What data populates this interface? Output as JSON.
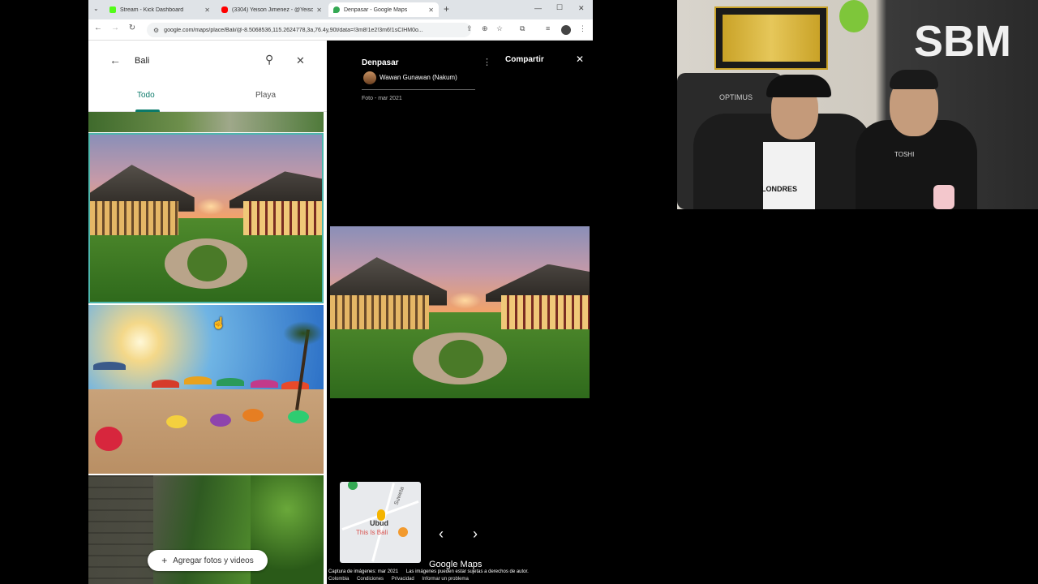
{
  "browser": {
    "tabs": [
      {
        "title": "Stream - Kick Dashboard",
        "favicon_color": "#53fc18"
      },
      {
        "title": "(3304) Yeison Jimenez - @Yeiso",
        "favicon_color": "#ff0000"
      },
      {
        "title": "Denpasar - Google Maps",
        "favicon_color": "#34a853"
      }
    ],
    "new_tab": "+",
    "url": "google.com/maps/place/Bali/@-8.5068536,115.2624778,3a,76.4y,90t/data=!3m8!1e2!3m6!1sCIHM0o...",
    "window_controls": [
      "—",
      "☐",
      "✕"
    ]
  },
  "search": {
    "value": "Bali",
    "back": "←",
    "search_icon": "⚲",
    "clear": "✕"
  },
  "filter_tabs": {
    "todo": "Todo",
    "playa": "Playa"
  },
  "add_photos": {
    "plus": "+",
    "label": "Agregar fotos y videos"
  },
  "viewer": {
    "place": "Denpasar",
    "author": "Wawan Gunawan (Nakum)",
    "meta": "Foto - mar 2021",
    "share": "Compartir",
    "close": "✕",
    "more": "⋮",
    "minimap_label_1": "Ubud",
    "minimap_label_2": "This Is Bali",
    "minimap_road": "Suweta",
    "prev": "‹",
    "next": "›",
    "logo": "Google Maps",
    "capture": "Captura de imágenes: mar 2021",
    "copyright": "Las imágenes pueden estar sujetas a derechos de autor.",
    "links": [
      "Colombia",
      "Condiciones",
      "Privacidad",
      "Informar un problema"
    ]
  },
  "webcam": {
    "sign": "SBM",
    "chair_brand": "OPTIMUS",
    "shirt_text": "LONDRES",
    "shirt2_text": "TOSHI"
  },
  "colors": {
    "accent": "#0b7a6a",
    "viewer_bg": "#000000"
  }
}
